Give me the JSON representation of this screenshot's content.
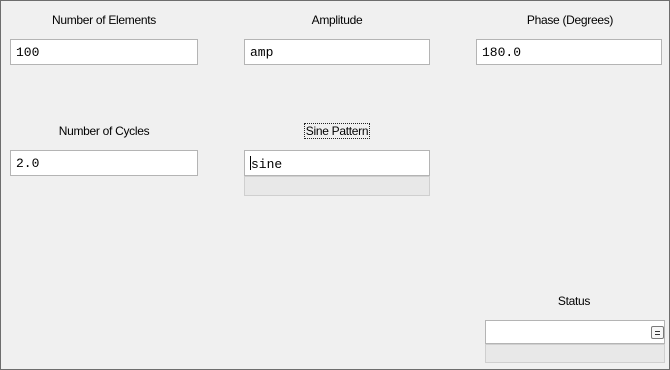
{
  "fields": {
    "num_elements": {
      "label": "Number of Elements",
      "value": "100"
    },
    "amplitude": {
      "label": "Amplitude",
      "value": "amp"
    },
    "phase": {
      "label": "Phase (Degrees)",
      "value": "180.0"
    },
    "num_cycles": {
      "label": "Number of Cycles",
      "value": "2.0"
    },
    "sine_pattern": {
      "label": "Sine Pattern",
      "value": "sine"
    }
  },
  "status": {
    "label": "Status",
    "value": "",
    "button_icon": "menu-icon"
  }
}
